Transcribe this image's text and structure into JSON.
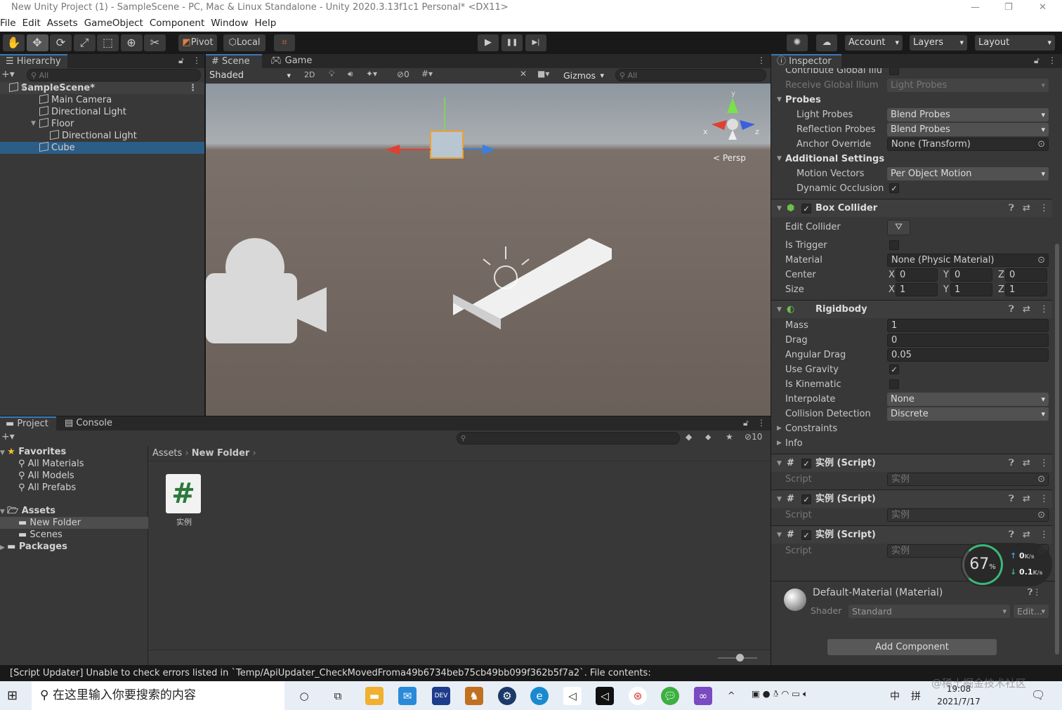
{
  "window": {
    "title": "New Unity Project (1) - SampleScene - PC, Mac & Linux Standalone - Unity 2020.3.13f1c1 Personal* <DX11>",
    "minimize": "—",
    "restore": "❐",
    "close": "✕"
  },
  "menu": [
    "File",
    "Edit",
    "Assets",
    "GameObject",
    "Component",
    "Window",
    "Help"
  ],
  "toolbar": {
    "tools": [
      "hand-tool",
      "move-tool",
      "rotate-tool",
      "scale-tool",
      "rect-tool",
      "transform-tool",
      "custom-tool"
    ],
    "tool_glyphs": [
      "✋",
      "✥",
      "⟳",
      "⤢",
      "⬚",
      "⊕",
      "✂"
    ],
    "active_tool": 1,
    "pivot": "Pivot",
    "local": "Local",
    "play": "▶",
    "pause": "❚❚",
    "step": "▶|",
    "account": "Account",
    "layers": "Layers",
    "layout": "Layout"
  },
  "hierarchy": {
    "tab": "Hierarchy",
    "search_placeholder": "All",
    "items": [
      {
        "label": "SampleScene*",
        "depth": 0,
        "expanded": true,
        "scene": true
      },
      {
        "label": "Main Camera",
        "depth": 1
      },
      {
        "label": "Directional Light",
        "depth": 1
      },
      {
        "label": "Floor",
        "depth": 1,
        "expanded": true
      },
      {
        "label": "Directional Light",
        "depth": 2
      },
      {
        "label": "Cube",
        "depth": 1,
        "selected": true
      }
    ]
  },
  "scene": {
    "tabs": [
      "Scene",
      "Game"
    ],
    "shading": "Shaded",
    "mode_2d": "2D",
    "hidden_count": "0",
    "gizmos": "Gizmos",
    "search_placeholder": "All",
    "persp": "< Persp",
    "axes": {
      "x": "x",
      "y": "y",
      "z": "z"
    }
  },
  "project": {
    "tabs": [
      "Project",
      "Console"
    ],
    "hidden_count": "10",
    "favorites": "Favorites",
    "favorite_items": [
      "All Materials",
      "All Models",
      "All Prefabs"
    ],
    "assets": "Assets",
    "asset_items": [
      "New Folder",
      "Scenes"
    ],
    "packages": "Packages",
    "breadcrumb": [
      "Assets",
      "New Folder"
    ],
    "files": [
      {
        "name": "实例",
        "icon": "#"
      }
    ]
  },
  "inspector": {
    "tab": "Inspector",
    "rows": [
      {
        "type": "check",
        "label": "Contribute Global Illu",
        "checked": false
      },
      {
        "type": "dropdown",
        "label": "Receive Global Illum",
        "value": "Light Probes",
        "disabled": true
      },
      {
        "type": "section",
        "label": "Probes"
      },
      {
        "type": "dropdown",
        "label": "Light Probes",
        "value": "Blend Probes",
        "sub": true
      },
      {
        "type": "dropdown",
        "label": "Reflection Probes",
        "value": "Blend Probes",
        "sub": true
      },
      {
        "type": "object",
        "label": "Anchor Override",
        "value": "None (Transform)",
        "sub": true
      },
      {
        "type": "section",
        "label": "Additional Settings"
      },
      {
        "type": "dropdown",
        "label": "Motion Vectors",
        "value": "Per Object Motion",
        "sub": true
      },
      {
        "type": "check",
        "label": "Dynamic Occlusion",
        "checked": true,
        "sub": true
      },
      {
        "type": "header",
        "label": "Box Collider",
        "icon": "box-collider",
        "enabled": true
      },
      {
        "type": "button",
        "label": "Edit Collider",
        "value": "⛛"
      },
      {
        "type": "check",
        "label": "Is Trigger",
        "checked": false
      },
      {
        "type": "object",
        "label": "Material",
        "value": "None (Physic Material)"
      },
      {
        "type": "xyz",
        "label": "Center",
        "value": [
          "0",
          "0",
          "0"
        ]
      },
      {
        "type": "xyz",
        "label": "Size",
        "value": [
          "1",
          "1",
          "1"
        ]
      },
      {
        "type": "header",
        "label": "Rigidbody",
        "icon": "rigidbody"
      },
      {
        "type": "field",
        "label": "Mass",
        "value": "1"
      },
      {
        "type": "field",
        "label": "Drag",
        "value": "0"
      },
      {
        "type": "field",
        "label": "Angular Drag",
        "value": "0.05"
      },
      {
        "type": "check",
        "label": "Use Gravity",
        "checked": true
      },
      {
        "type": "check",
        "label": "Is Kinematic",
        "checked": false
      },
      {
        "type": "dropdown",
        "label": "Interpolate",
        "value": "None"
      },
      {
        "type": "dropdown",
        "label": "Collision Detection",
        "value": "Discrete"
      },
      {
        "type": "foldout",
        "label": "Constraints"
      },
      {
        "type": "foldout",
        "label": "Info"
      },
      {
        "type": "header",
        "label": "实例 (Script)",
        "icon": "script",
        "enabled": true
      },
      {
        "type": "object",
        "label": "Script",
        "value": "实例",
        "disabled": true
      },
      {
        "type": "header",
        "label": "实例 (Script)",
        "icon": "script",
        "enabled": true
      },
      {
        "type": "object",
        "label": "Script",
        "value": "实例",
        "disabled": true
      },
      {
        "type": "header",
        "label": "实例 (Script)",
        "icon": "script",
        "enabled": true
      },
      {
        "type": "object",
        "label": "Script",
        "value": "实例",
        "disabled": true
      }
    ],
    "material": {
      "name": "Default-Material (Material)",
      "shader_label": "Shader",
      "shader": "Standard",
      "edit": "Edit..."
    },
    "add_component": "Add Component"
  },
  "overlay": {
    "percent": "67",
    "unit": "%",
    "up": "0",
    "up_unit": "K/s",
    "down": "0.1",
    "down_unit": "K/s"
  },
  "statusbar": {
    "message": "[Script Updater] Unable to check errors listed in `Temp/ApiUpdater_CheckMovedFroma49b6734beb75cb49bb099f362b5f7a2`. File contents:"
  },
  "taskbar": {
    "search_placeholder": "在这里输入你要搜索的内容",
    "time": "19:08",
    "date": "2021/7/17",
    "tray": [
      "^",
      "中",
      "拼"
    ],
    "watermark": "@稀土掘金技术社区"
  },
  "colors": {
    "accent": "#3a79bb",
    "selection": "#2c5d87",
    "panel": "#383838"
  }
}
